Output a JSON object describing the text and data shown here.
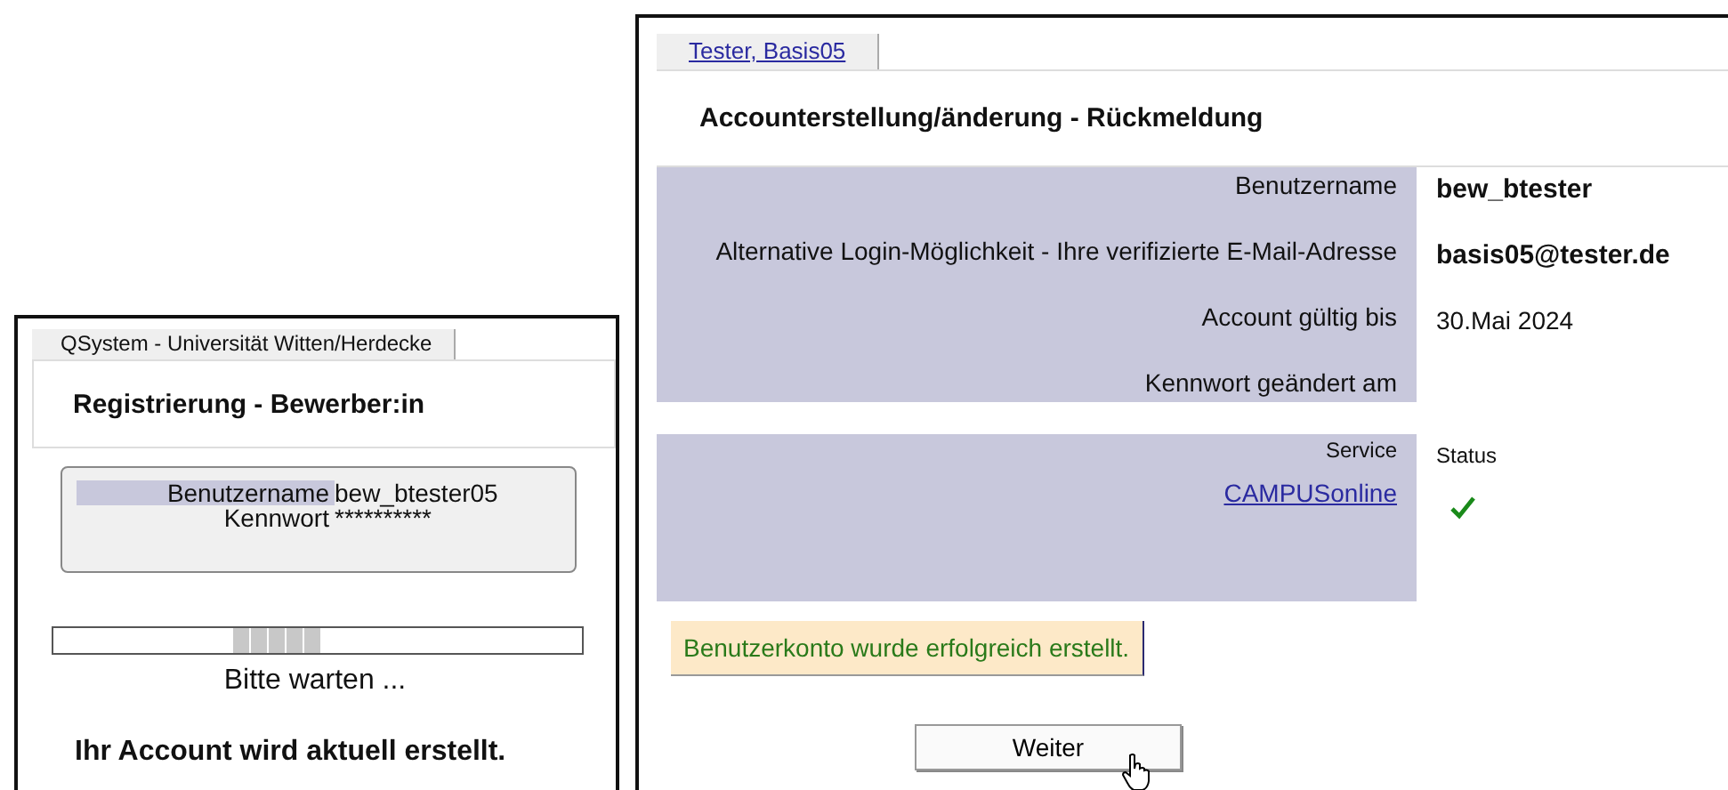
{
  "registration_window": {
    "tab": "QSystem - Universität Witten/Herdecke",
    "heading": "Registrierung - Bewerber:in",
    "credentials": [
      {
        "label": "Benutzername",
        "value": "bew_btester05"
      },
      {
        "label": "Kennwort",
        "value": "**********"
      }
    ],
    "wait_text": "Bitte warten ...",
    "message": "Ihr Account wird aktuell erstellt."
  },
  "feedback_window": {
    "tab": "Tester, Basis05",
    "heading": "Accounterstellung/änderung - Rückmeldung",
    "account_rows": [
      {
        "label": "Benutzername",
        "value": "bew_btester",
        "bold": true
      },
      {
        "label": "Alternative Login-Möglichkeit - Ihre verifizierte E-Mail-Adresse",
        "value": "basis05@tester.de",
        "bold": true
      },
      {
        "label": "Account gültig bis",
        "value": "30.Mai 2024",
        "bold": false
      },
      {
        "label": "Kennwort geändert am"
      }
    ],
    "service_table": {
      "columns": [
        "Service",
        "Status"
      ],
      "rows": [
        {
          "service": "CAMPUSonline",
          "ok": true
        }
      ]
    },
    "success_message": "Benutzerkonto wurde erfolgreich erstellt.",
    "button": "Weiter"
  }
}
